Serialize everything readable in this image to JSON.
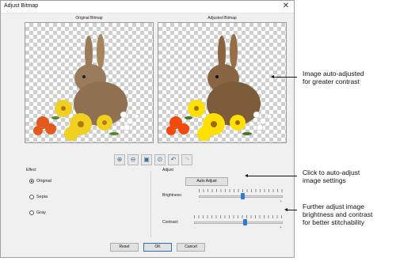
{
  "dialog": {
    "title": "Adjust Bitmap",
    "close_glyph": "✕"
  },
  "preview": {
    "original_label": "Original Bitmap",
    "adjusted_label": "Adjusted Bitmap"
  },
  "toolbar": {
    "icons": [
      "zoom-in-icon",
      "zoom-out-icon",
      "zoom-box-icon",
      "zoom-fit-icon",
      "undo-icon",
      "redo-icon"
    ]
  },
  "effect": {
    "label": "Effect",
    "options": [
      "Original",
      "Sepia",
      "Gray"
    ],
    "selected": "Original"
  },
  "adjust": {
    "label": "Adjust",
    "auto_adjust": "Auto Adjust",
    "brightness_label": "Brightness:",
    "contrast_label": "Contrast:",
    "brightness_value": 0.52,
    "contrast_value": 0.58,
    "minus": "-",
    "plus": "+"
  },
  "footer": {
    "reset": "Reset",
    "ok": "OK",
    "cancel": "Cancel"
  },
  "annotations": {
    "image_note": [
      "Image auto-adjusted",
      "for greater contrast"
    ],
    "auto_note": [
      "Click to auto-adjust",
      "image settings"
    ],
    "further_note": [
      "Further adjust image",
      "brightness and contrast",
      "for better stitchability"
    ]
  }
}
